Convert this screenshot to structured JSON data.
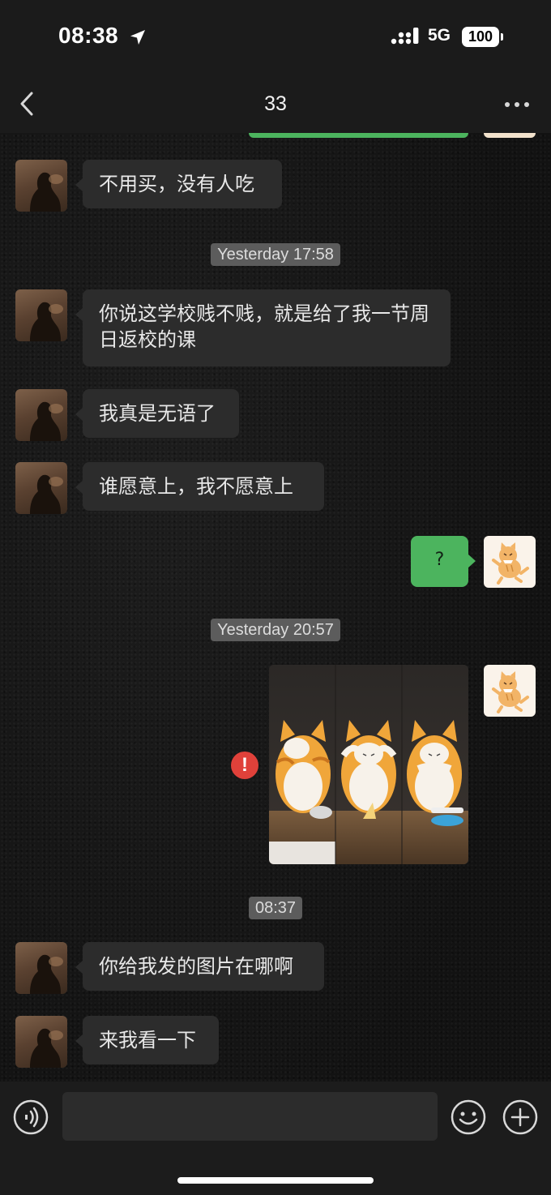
{
  "status_bar": {
    "time": "08:38",
    "network": "5G",
    "battery": "100"
  },
  "header": {
    "title": "33",
    "back_icon": "chevron-left-icon",
    "more_icon": "ellipsis-icon"
  },
  "timestamps": [
    "Yesterday 17:58",
    "Yesterday 20:57",
    "08:37"
  ],
  "messages": [
    {
      "side": "left",
      "text": "不用买，没有人吃"
    },
    {
      "side": "left",
      "text": "你说这学校贱不贱，就是给了我一节周日返校的课"
    },
    {
      "side": "left",
      "text": "我真是无语了"
    },
    {
      "side": "left",
      "text": "谁愿意上，我不愿意上"
    },
    {
      "side": "right",
      "text": "?"
    },
    {
      "side": "right",
      "type": "image",
      "status": "failed",
      "status_icon_text": "!"
    },
    {
      "side": "left",
      "text": "你给我发的图片在哪啊"
    },
    {
      "side": "left",
      "text": "来我看一下"
    }
  ],
  "input_bar": {
    "voice_icon": "voice-icon",
    "emoji_icon": "emoji-icon",
    "plus_icon": "plus-icon",
    "placeholder": ""
  },
  "colors": {
    "sent_bubble": "#4cb45e",
    "received_bubble": "#2c2c2c",
    "error": "#e0413a",
    "background": "#121212"
  }
}
